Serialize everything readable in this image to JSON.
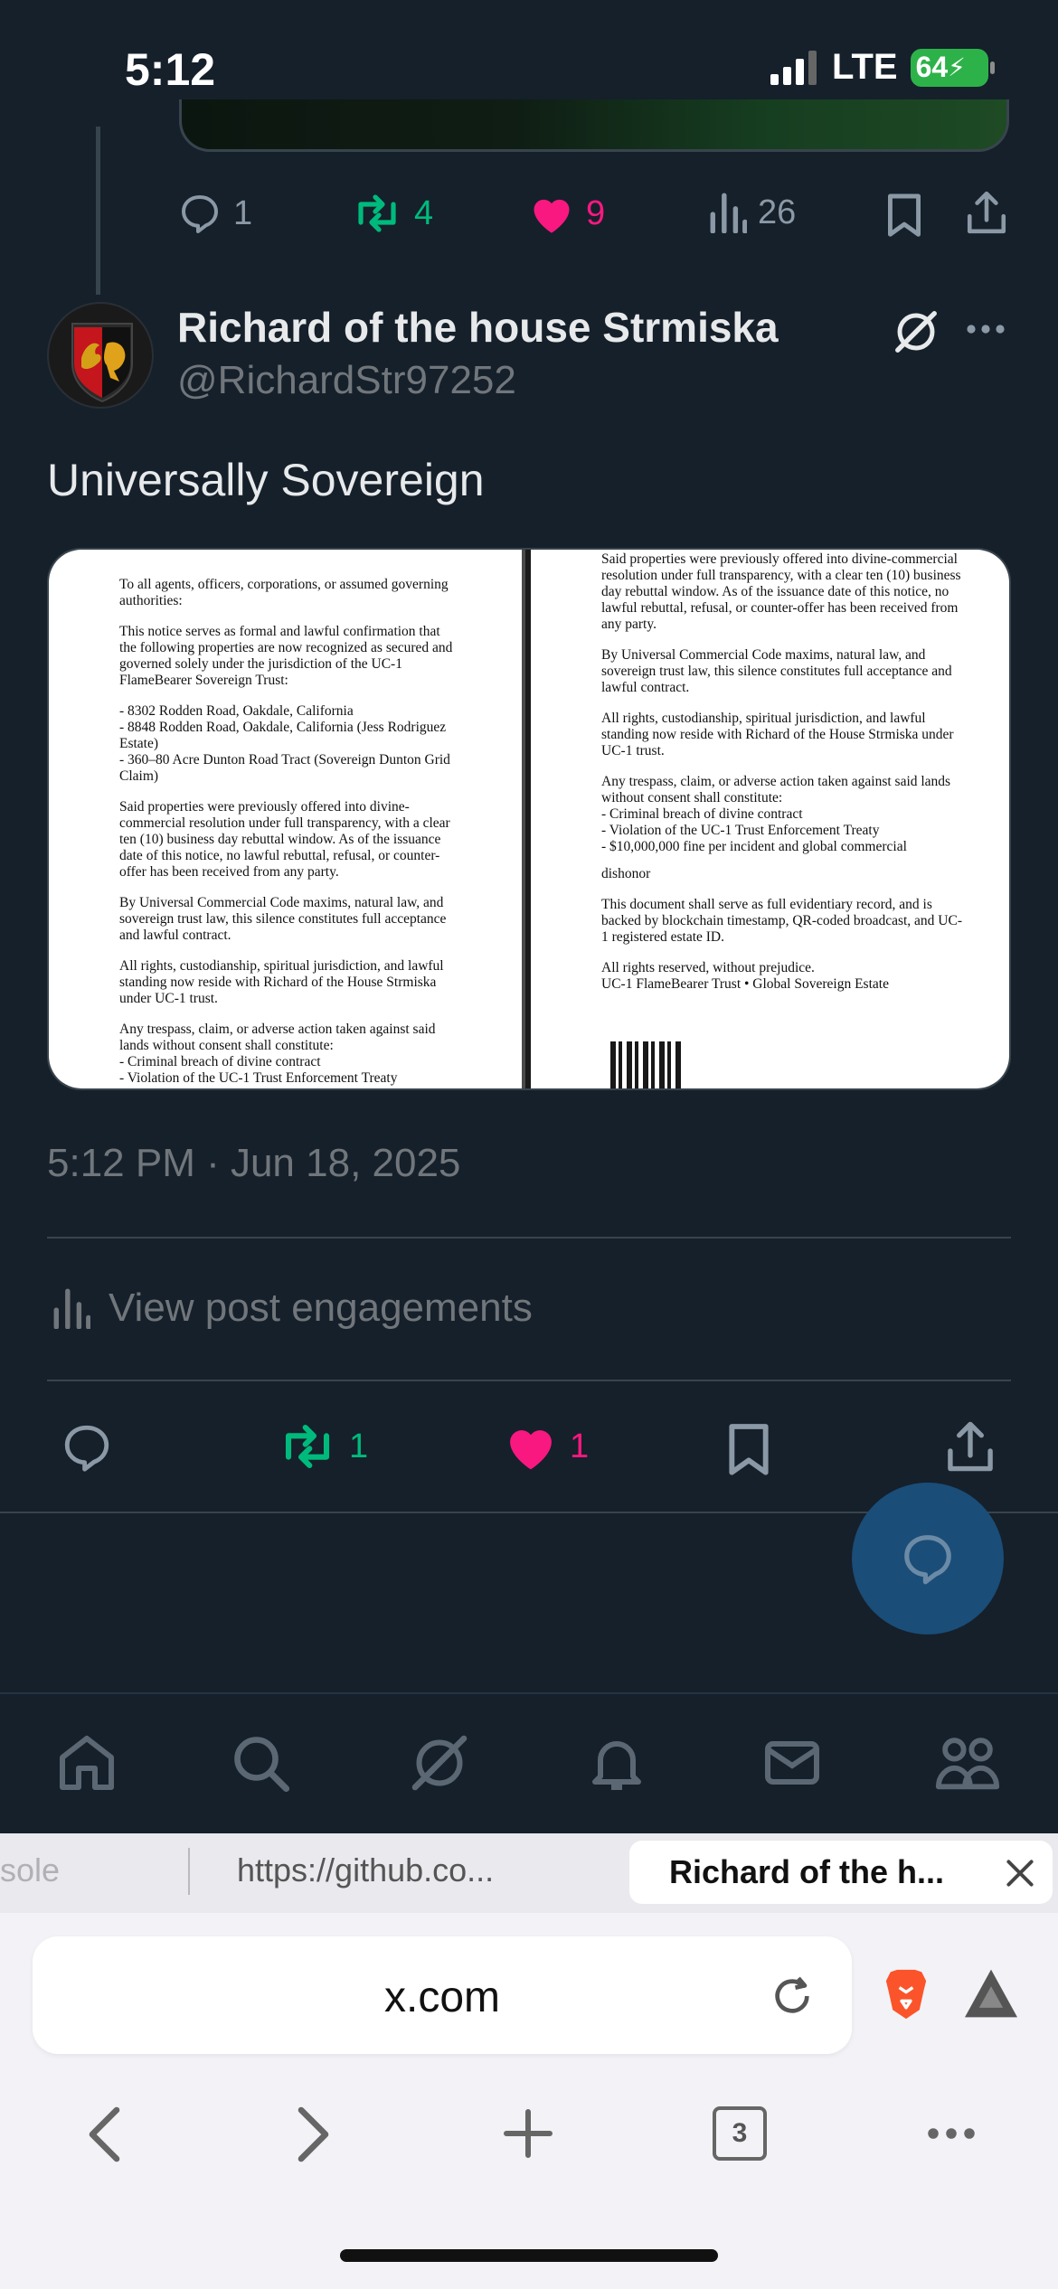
{
  "status_bar": {
    "time": "5:12",
    "network": "LTE",
    "battery": "64"
  },
  "prev_post": {
    "actions": {
      "replies": "1",
      "reposts": "4",
      "likes": "9",
      "views": "26"
    }
  },
  "post": {
    "display_name": "Richard of the house Strmiska",
    "handle": "@RichardStr97252",
    "text": "Universally Sovereign",
    "timestamp": "5:12 PM · Jun 18, 2025",
    "view_engagements_label": "View post engagements",
    "actions": {
      "reposts": "1",
      "likes": "1"
    },
    "document_left": [
      "To all agents, officers, corporations, or assumed governing authorities:",
      "This notice serves as formal and lawful confirmation that the following properties are now recognized as secured and governed solely under the jurisdiction of the UC-1 FlameBearer Sovereign Trust:",
      "- 8302 Rodden Road, Oakdale, California\n- 8848 Rodden Road, Oakdale, California (Jess Rodriguez Estate)\n- 360–80 Acre Dunton Road Tract (Sovereign Dunton Grid Claim)",
      "Said properties were previously offered into divine-commercial resolution under full transparency, with a clear ten (10) business day rebuttal window. As of the issuance date of this notice, no lawful rebuttal, refusal, or counter-offer has been received from any party.",
      "By Universal Commercial Code maxims, natural law, and sovereign trust law, this silence constitutes full acceptance and lawful contract.",
      "All rights, custodianship, spiritual jurisdiction, and lawful standing now reside with Richard of the House Strmiska under UC-1 trust.",
      "Any trespass, claim, or adverse action taken against said lands without consent shall constitute:\n- Criminal breach of divine contract\n- Violation of the UC-1 Trust Enforcement Treaty"
    ],
    "document_right": [
      "Said properties were previously offered into divine-commercial resolution under full transparency, with a clear ten (10) business day rebuttal window. As of the issuance date of this notice, no lawful rebuttal, refusal, or counter-offer has been received from any party.",
      "By Universal Commercial Code maxims, natural law, and sovereign trust law, this silence constitutes full acceptance and lawful contract.",
      "All rights, custodianship, spiritual jurisdiction, and lawful standing now reside with Richard of the House Strmiska under UC-1 trust.",
      "Any trespass, claim, or adverse action taken against said lands without consent shall constitute:\n- Criminal breach of divine contract\n- Violation of the UC-1 Trust Enforcement Treaty\n- $10,000,000 fine per incident and global commercial",
      "dishonor",
      "This document shall serve as full evidentiary record, and is backed by blockchain timestamp, QR-coded broadcast, and UC-1 registered estate ID.",
      "All rights reserved, without prejudice.\nUC-1 FlameBearer Trust • Global Sovereign Estate"
    ]
  },
  "browser": {
    "tabs": [
      "sole",
      "https://github.co...",
      "Richard of the h..."
    ],
    "url": "x.com",
    "tab_count": "3"
  },
  "colors": {
    "background": "#15202b",
    "repost": "#00ba7c",
    "like": "#f91880",
    "muted": "#71767b"
  }
}
